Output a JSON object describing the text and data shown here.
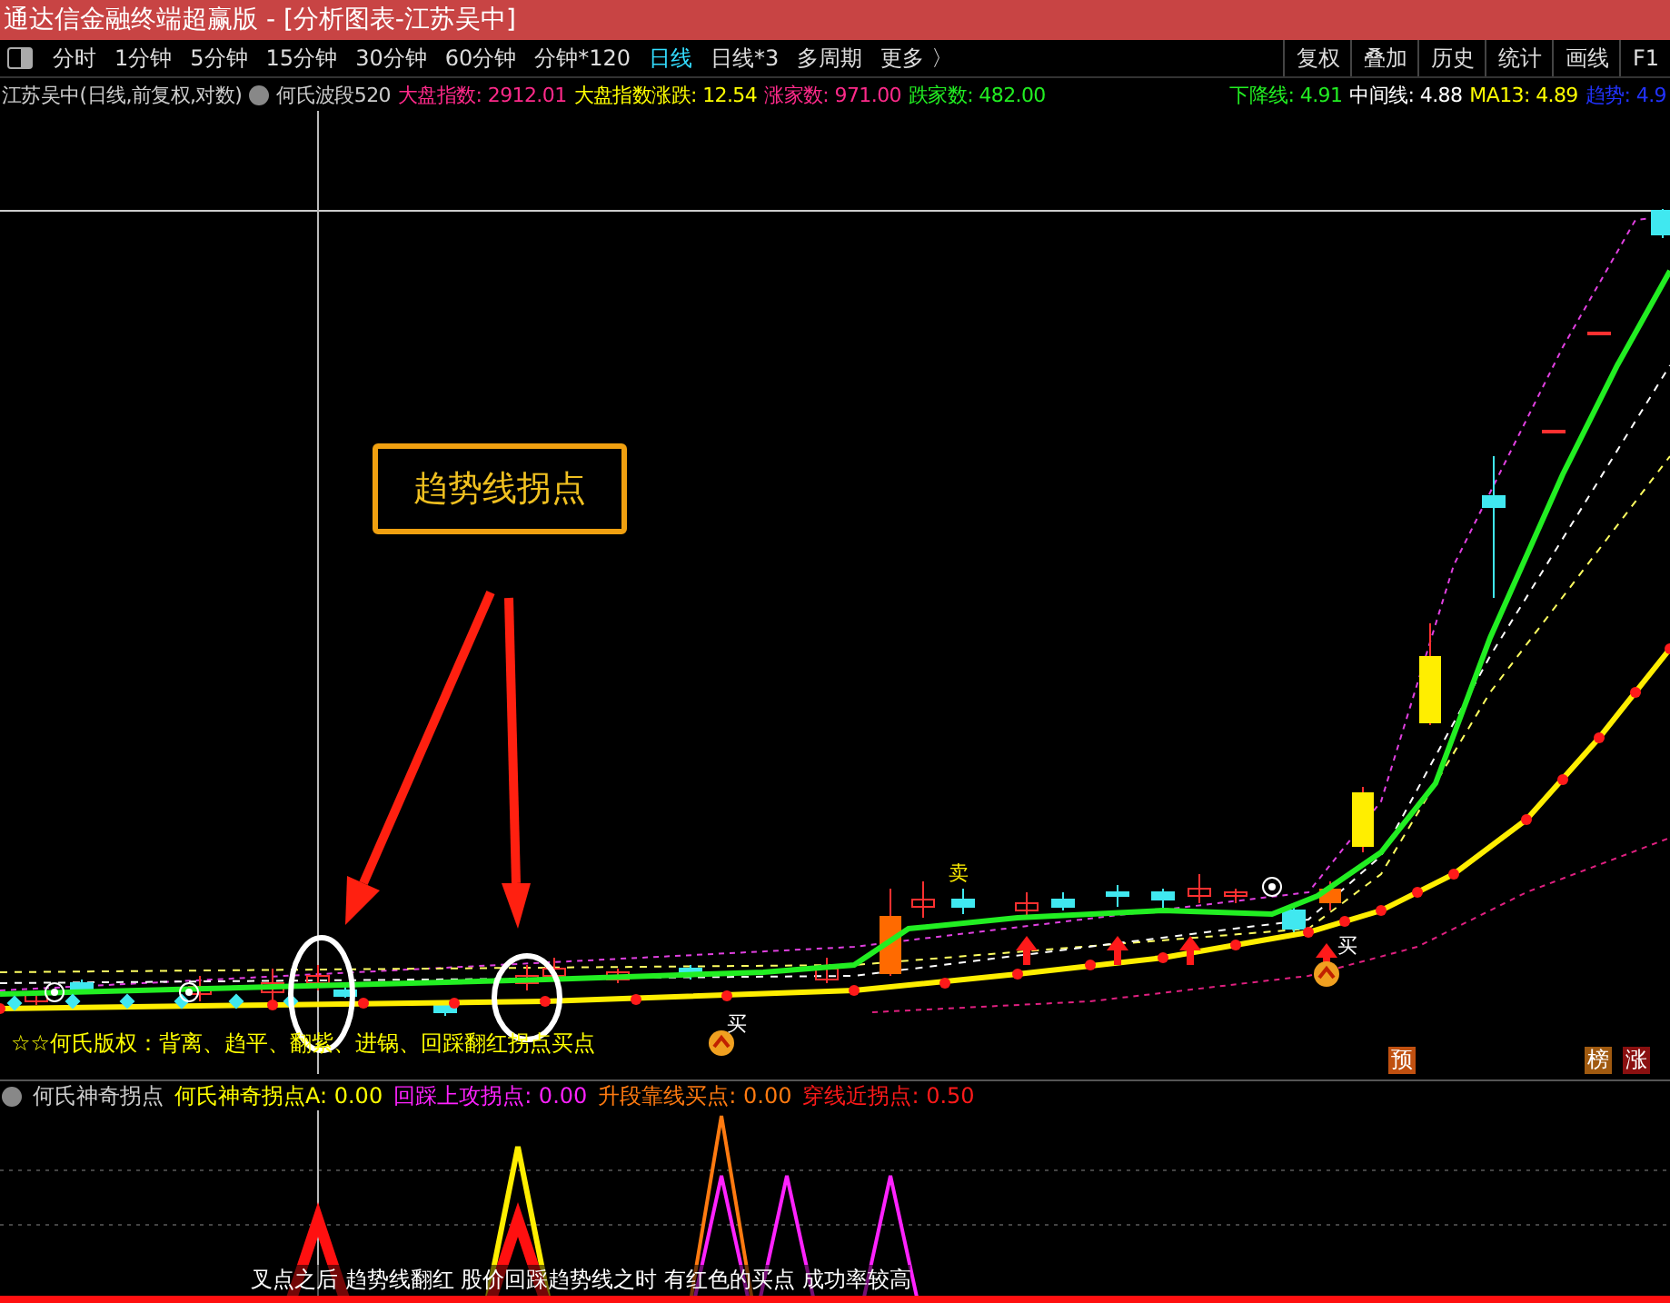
{
  "window": {
    "title": "通达信金融终端超赢版 - [分析图表-江苏吴中]"
  },
  "toolbar": {
    "periods": [
      {
        "label": "分时",
        "selected": false
      },
      {
        "label": "1分钟",
        "selected": false
      },
      {
        "label": "5分钟",
        "selected": false
      },
      {
        "label": "15分钟",
        "selected": false
      },
      {
        "label": "30分钟",
        "selected": false
      },
      {
        "label": "60分钟",
        "selected": false
      },
      {
        "label": "分钟*120",
        "selected": false
      },
      {
        "label": "日线",
        "selected": true
      },
      {
        "label": "日线*3",
        "selected": false
      },
      {
        "label": "多周期",
        "selected": false
      },
      {
        "label": "更多 〉",
        "selected": false
      }
    ],
    "tools": [
      "复权",
      "叠加",
      "历史",
      "统计",
      "画线",
      "F1"
    ]
  },
  "main_chart": {
    "title": "江苏吴中(日线,前复权,对数)",
    "indicator": "何氏波段520",
    "readings_left": [
      {
        "text": "大盘指数: 2912.01",
        "color": "#ff2a8a"
      },
      {
        "text": "大盘指数涨跌: 12.54",
        "color": "#ffff00"
      },
      {
        "text": "涨家数: 971.00",
        "color": "#ff2a8a"
      },
      {
        "text": "跌家数: 482.00",
        "color": "#22ee22"
      }
    ],
    "readings_right": [
      {
        "text": "下降线: 4.91",
        "color": "#22ee22"
      },
      {
        "text": "中间线: 4.88",
        "color": "#ffffff"
      },
      {
        "text": "MA13: 4.89",
        "color": "#ffff00"
      },
      {
        "text": "趋势: 4.9",
        "color": "#2233ff"
      }
    ],
    "callout": "趋势线拐点",
    "note": "☆☆何氏版权：背离、趋平、翻紫、进锅、回踩翻红拐点买点",
    "signals": [
      {
        "text": "买"
      },
      {
        "text": "卖"
      },
      {
        "text": "买"
      }
    ],
    "badges": [
      {
        "text": "预",
        "color": "#c05010"
      },
      {
        "text": "榜",
        "color": "#a05a10"
      },
      {
        "text": "涨",
        "color": "#8a1010"
      }
    ]
  },
  "sub_chart": {
    "title": "何氏神奇拐点",
    "readings": [
      {
        "text": "何氏神奇拐点A: 0.00",
        "color": "#ffff00"
      },
      {
        "text": "回踩上攻拐点: 0.00",
        "color": "#ff22ff"
      },
      {
        "text": "升段靠线买点: 0.00",
        "color": "#ff7a10"
      },
      {
        "text": "穿线近拐点: 0.50",
        "color": "#ff1a1a"
      }
    ],
    "note": "叉点之后 趋势线翻红 股价回踩趋势线之时 有红色的买点 成功率较高"
  }
}
